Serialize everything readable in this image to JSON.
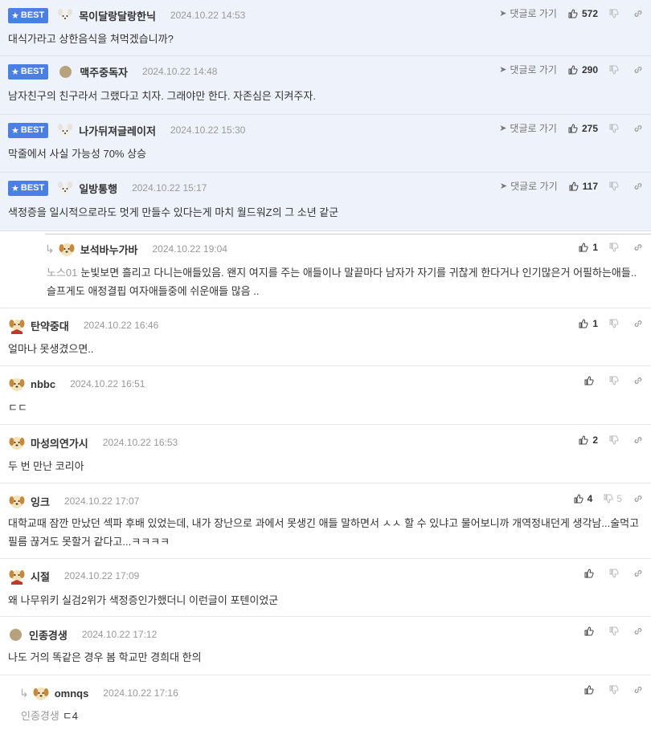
{
  "labels": {
    "best": "BEST",
    "goto": "댓글로 가기"
  },
  "comments": [
    {
      "best": true,
      "nick": "목이달랑달랑한닉",
      "date": "2024.10.22 14:53",
      "text": "대식가라고 상한음식을 쳐먹겠습니까?",
      "up": "572",
      "down": "",
      "avatar": "dog-white"
    },
    {
      "best": true,
      "nick": "맥주중독자",
      "date": "2024.10.22 14:48",
      "text": "남자친구의 친구라서 그랬다고 치자. 그래야만 한다. 자존심은 지켜주자.",
      "up": "290",
      "down": "",
      "avatar": "dot"
    },
    {
      "best": true,
      "nick": "나가뒤져글레이저",
      "date": "2024.10.22 15:30",
      "text": "막줄에서 사실 가능성 70% 상승",
      "up": "275",
      "down": "",
      "avatar": "dog-white"
    },
    {
      "best": true,
      "nick": "일방통행",
      "date": "2024.10.22 15:17",
      "text": "색정증을 일시적으로라도 멋게 만들수 있다는게 마치 월드워Z의 그 소년 같군",
      "up": "117",
      "down": "",
      "avatar": "dog-white"
    },
    {
      "reply": true,
      "nick": "보석바누가바",
      "date": "2024.10.22 19:04",
      "mention": "노스01",
      "text": "눈빛보면 흘리고 다니는애들있음. 왠지 여지를 주는 애들이나 말끝마다 남자가 자기를 귀찮게 한다거나 인기많은거 어필하는애들.. 슬프게도 애정결핍 여자애들중에 쉬운애들 많음 ..",
      "up": "1",
      "down": "",
      "avatar": "dog-tan"
    },
    {
      "nick": "탄약중대",
      "date": "2024.10.22 16:46",
      "text": "얼마나 못생겼으면..",
      "up": "1",
      "down": "",
      "avatar": "dog-red"
    },
    {
      "nick": "nbbc",
      "date": "2024.10.22 16:51",
      "text": "ㄷㄷ",
      "up": "",
      "down": "",
      "avatar": "dog-tan"
    },
    {
      "nick": "마성의연가시",
      "date": "2024.10.22 16:53",
      "text": "두 번 만난 코리아",
      "up": "2",
      "down": "",
      "avatar": "dog-tan"
    },
    {
      "nick": "잉크",
      "date": "2024.10.22 17:07",
      "text": "대학교때 잠깐 만났던 섹파 후배 있었는데, 내가 장난으로 과에서 못생긴 애들 말하면서 ㅅㅅ 할 수 있냐고 물어보니까 개역정내던게 생각남...술먹고 필름 끊겨도 못할거 같다고...ㅋㅋㅋㅋ",
      "up": "4",
      "down": "5",
      "avatar": "dog-tan"
    },
    {
      "nick": "시절",
      "date": "2024.10.22 17:09",
      "text": "왜 나무위키 실검2위가 색정증인가했더니 이런글이 포텐이었군",
      "up": "",
      "down": "",
      "avatar": "dog-red"
    },
    {
      "nick": "인종경생",
      "date": "2024.10.22 17:12",
      "text": "나도 거의 똑같은 경우 봄 학교만 경희대 한의",
      "up": "",
      "down": "",
      "avatar": "dot"
    },
    {
      "reply": true,
      "nick": "omnqs",
      "date": "2024.10.22 17:16",
      "mention": "인종경생",
      "text": "ㄷ4",
      "up": "",
      "down": "",
      "avatar": "dog-tan"
    }
  ]
}
